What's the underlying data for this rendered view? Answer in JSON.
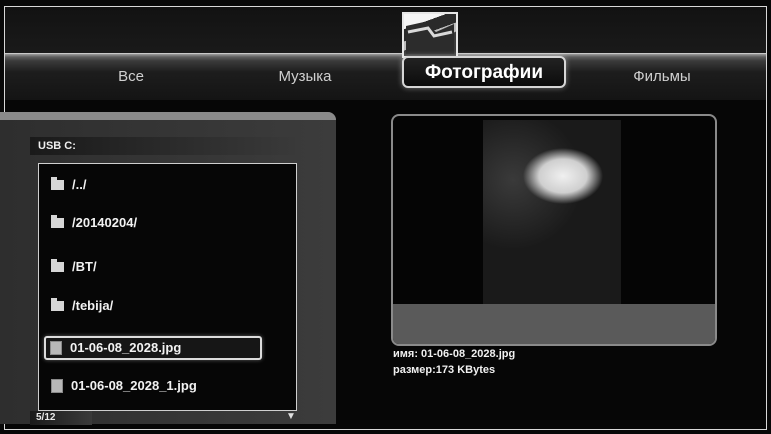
{
  "tabs": [
    {
      "label": "Все",
      "active": false
    },
    {
      "label": "Музыка",
      "active": false
    },
    {
      "label": "Фотографии",
      "active": true
    },
    {
      "label": "Фильмы",
      "active": false
    }
  ],
  "browser": {
    "path": "USB C:",
    "items": [
      {
        "name": "/../",
        "type": "folder"
      },
      {
        "name": "/20140204/",
        "type": "folder"
      },
      {
        "name": "/BT/",
        "type": "folder"
      },
      {
        "name": "/tebija/",
        "type": "folder"
      },
      {
        "name": "01-06-08_2028.jpg",
        "type": "file",
        "selected": true
      },
      {
        "name": "01-06-08_2028_1.jpg",
        "type": "file"
      }
    ],
    "counter": "5/12",
    "scroll_icon": "down-arrow-icon"
  },
  "details": {
    "name_line": "имя: 01-06-08_2028.jpg",
    "size_line": "размер:173 KBytes"
  },
  "colors": {
    "accent": "#dcdcdc",
    "background": "#080808"
  }
}
